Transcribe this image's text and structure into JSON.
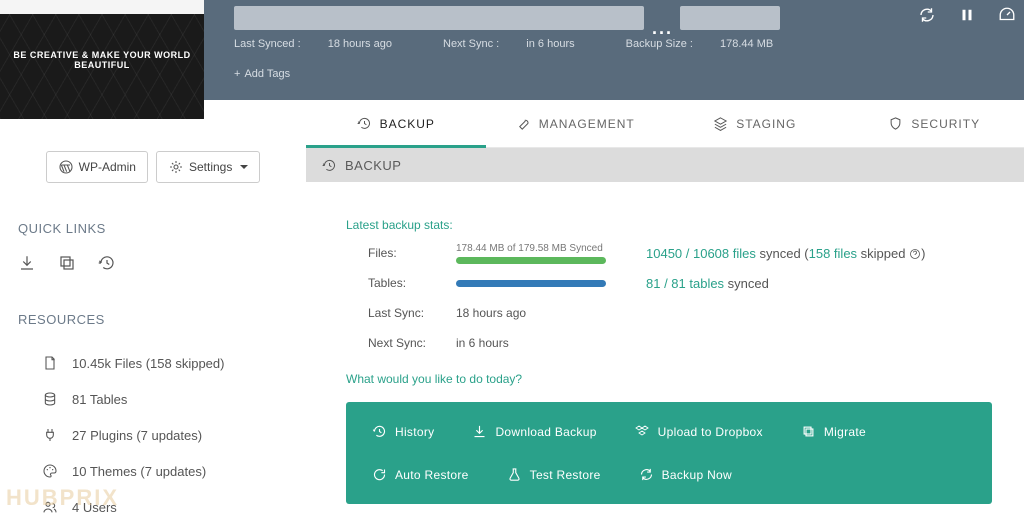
{
  "header": {
    "last_synced_label": "Last Synced : ",
    "last_synced_value": "18 hours ago",
    "next_sync_label": "Next Sync : ",
    "next_sync_value": "in 6 hours",
    "backup_size_label": "Backup Size : ",
    "backup_size_value": "178.44 MB",
    "add_tags": "Add Tags",
    "ellipsis": "...",
    "thumb_caption": "BE CREATIVE & MAKE YOUR WORLD BEAUTIFUL"
  },
  "sidebar": {
    "wp_admin": "WP-Admin",
    "settings": "Settings",
    "quick_links_title": "QUICK LINKS",
    "resources_title": "RESOURCES",
    "resources": {
      "files": "10.45k Files (158 skipped)",
      "tables": "81 Tables",
      "plugins": "27 Plugins (7 updates)",
      "themes": "10 Themes (7 updates)",
      "users": "4 Users"
    }
  },
  "tabs": {
    "backup": "BACKUP",
    "management": "MANAGEMENT",
    "staging": "STAGING",
    "security": "SECURITY"
  },
  "panel": {
    "head": "BACKUP",
    "stats_title": "Latest backup stats:",
    "rows": {
      "files_label": "Files:",
      "files_prog_label": "178.44 MB of 179.58 MB Synced",
      "files_result_a": "10450 / 10608 files",
      "files_result_b": " synced (",
      "files_result_c": "158 files ",
      "files_result_d": "skipped ",
      "tables_label": "Tables:",
      "tables_result_a": "81 / 81 tables",
      "tables_result_b": " synced",
      "lastsync_label": "Last Sync:",
      "lastsync_value": "18 hours ago",
      "nextsync_label": "Next Sync:",
      "nextsync_value": "in 6 hours"
    },
    "prompt": "What would you like to do today?",
    "actions": {
      "history": "History",
      "download": "Download Backup",
      "dropbox": "Upload to Dropbox",
      "migrate": "Migrate",
      "autorestore": "Auto Restore",
      "testrestore": "Test Restore",
      "backupnow": "Backup Now"
    }
  },
  "watermark": "HUBPRIX"
}
